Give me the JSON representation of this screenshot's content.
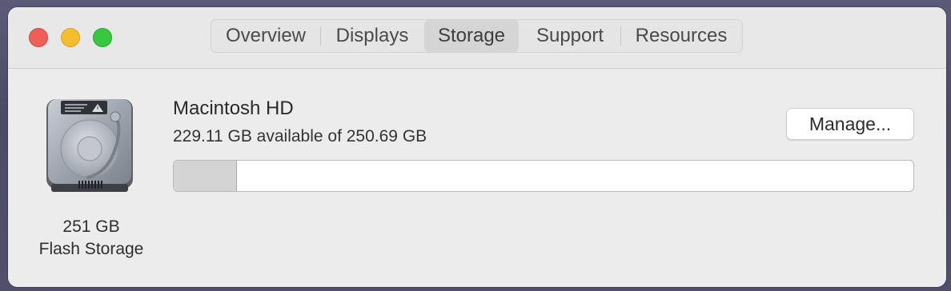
{
  "window": {
    "buttons": [
      "close",
      "minimize",
      "zoom"
    ]
  },
  "tabs": [
    {
      "label": "Overview",
      "selected": false
    },
    {
      "label": "Displays",
      "selected": false
    },
    {
      "label": "Storage",
      "selected": true
    },
    {
      "label": "Support",
      "selected": false
    },
    {
      "label": "Resources",
      "selected": false
    }
  ],
  "drive": {
    "icon": "hard-drive-icon",
    "capacity": "251 GB",
    "type": "Flash Storage"
  },
  "volume": {
    "name": "Macintosh HD",
    "availability": "229.11 GB available of 250.69 GB",
    "used_fraction": 0.086
  },
  "manage_button": {
    "label": "Manage..."
  },
  "colors": {
    "close": "#ee5f58",
    "minimize": "#f6bd2f",
    "zoom": "#38c840",
    "used_segment": "#d4d4d4"
  }
}
